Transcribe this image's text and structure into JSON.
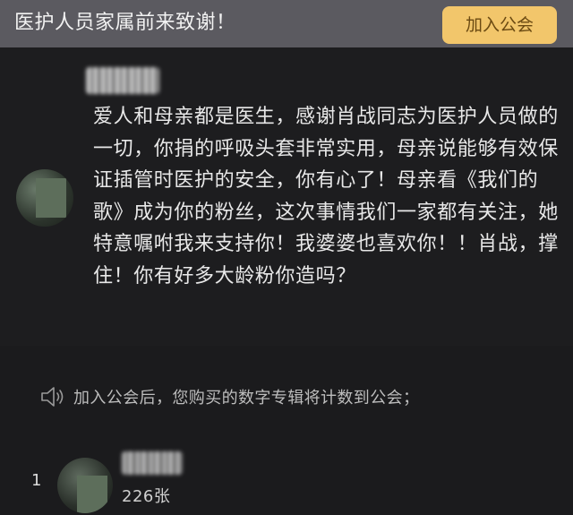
{
  "header": {
    "title": "医护人员家属前来致谢！",
    "join_button": "加入公会"
  },
  "post": {
    "username": "",
    "body": "爱人和母亲都是医生，感谢肖战同志为医护人员做的一切，你捐的呼吸头套非常实用，母亲说能够有效保证插管时医护的安全，你有心了！母亲看《我们的歌》成为你的粉丝，这次事情我们一家都有关注，她特意嘱咐我来支持你！我婆婆也喜欢你！！肖战，撑住！你有好多大龄粉你造吗？"
  },
  "notice": {
    "icon": "speaker-icon",
    "text": "加入公会后，您购买的数字专辑将计数到公会；"
  },
  "ranking": {
    "rows": [
      {
        "rank": "1",
        "count": "226张"
      }
    ]
  },
  "colors": {
    "header_bg": "#5b5a60",
    "page_bg": "#1d1d1f",
    "join_button_bg": "#f2c66b",
    "join_button_text": "#6b4a12"
  }
}
